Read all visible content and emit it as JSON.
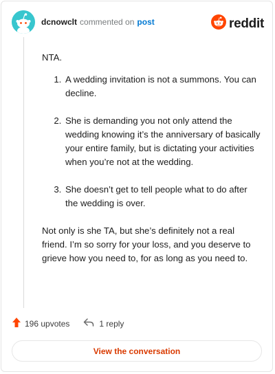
{
  "header": {
    "username": "dcnowclt",
    "action_text": "commented on",
    "post_link": "post",
    "brand_name": "reddit"
  },
  "comment": {
    "intro": "NTA.",
    "list_items": [
      "A wedding invitation is not a summons. You can decline.",
      "She is demanding you not only attend the wedding knowing it’s the anniversary of basically your entire family, but is dictating your activities when you’re not at the wedding.",
      "She doesn’t get to tell people what to do after the wedding is over."
    ],
    "closing": "Not only is she TA, but she’s definitely not a real friend. I’m so sorry for your loss, and you deserve to grieve how you need to, for as long as you need to."
  },
  "actions": {
    "upvotes": "196 upvotes",
    "replies": "1 reply"
  },
  "cta": {
    "label": "View the conversation"
  },
  "colors": {
    "accent": "#d93a00",
    "upvote": "#ff4500",
    "link": "#0079d3",
    "avatar": "#38c6ce"
  },
  "icons": [
    "snoo-avatar-icon",
    "reddit-logo-icon",
    "upvote-arrow-icon",
    "reply-arrow-icon"
  ]
}
